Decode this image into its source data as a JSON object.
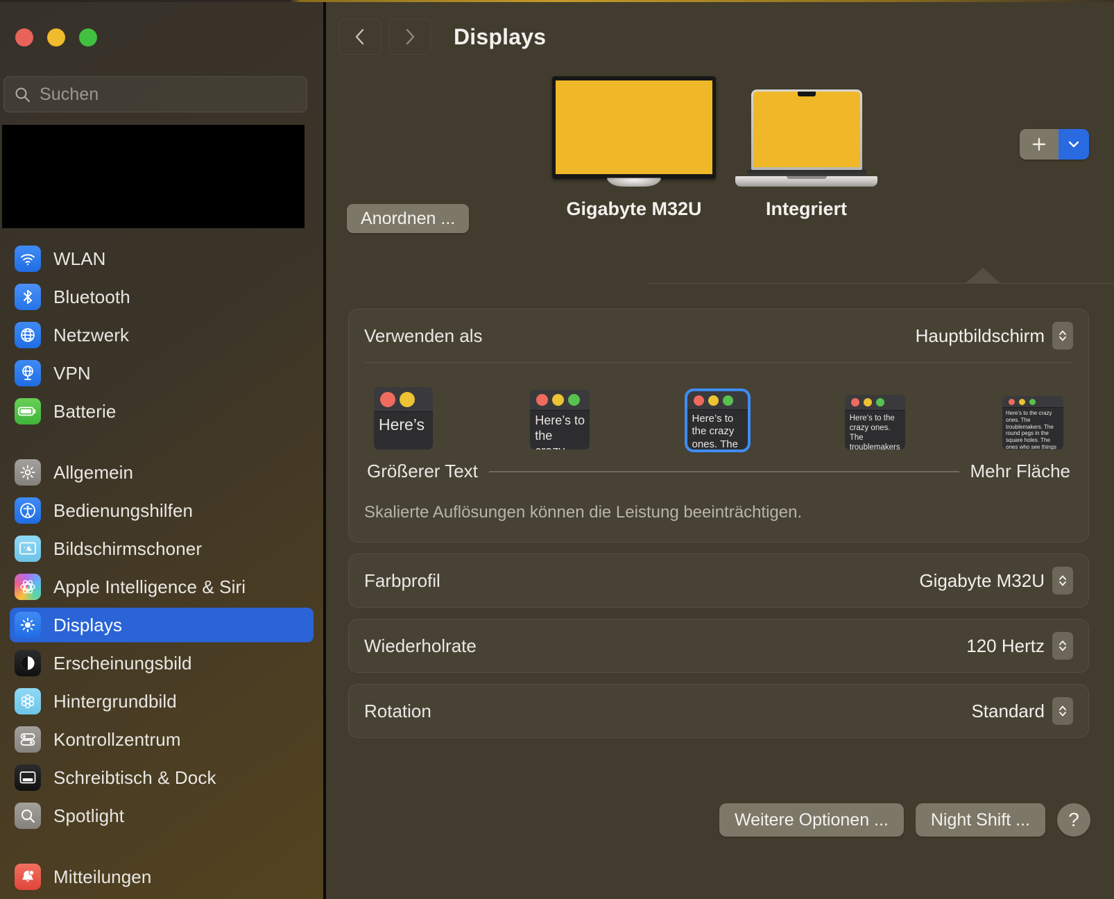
{
  "window": {
    "traffic_lights": [
      {
        "name": "close",
        "color": "#e8645a"
      },
      {
        "name": "minimize",
        "color": "#f0bb2c"
      },
      {
        "name": "zoom",
        "color": "#42c041"
      }
    ]
  },
  "sidebar": {
    "search": {
      "placeholder": "Suchen",
      "value": ""
    },
    "groups": [
      {
        "items": [
          {
            "label": "WLAN",
            "icon": "wifi-icon"
          },
          {
            "label": "Bluetooth",
            "icon": "bluetooth-icon"
          },
          {
            "label": "Netzwerk",
            "icon": "globe-icon"
          },
          {
            "label": "VPN",
            "icon": "vpn-globe-icon"
          },
          {
            "label": "Batterie",
            "icon": "battery-icon"
          }
        ]
      },
      {
        "items": [
          {
            "label": "Allgemein",
            "icon": "gear-icon"
          },
          {
            "label": "Bedienungshilfen",
            "icon": "accessibility-icon"
          },
          {
            "label": "Bildschirmschoner",
            "icon": "screensaver-icon"
          },
          {
            "label": "Apple Intelligence & Siri",
            "icon": "siri-icon"
          },
          {
            "label": "Displays",
            "icon": "brightness-icon",
            "selected": true
          },
          {
            "label": "Erscheinungsbild",
            "icon": "appearance-icon"
          },
          {
            "label": "Hintergrundbild",
            "icon": "wallpaper-icon"
          },
          {
            "label": "Kontrollzentrum",
            "icon": "control-center-icon"
          },
          {
            "label": "Schreibtisch & Dock",
            "icon": "desktop-dock-icon"
          },
          {
            "label": "Spotlight",
            "icon": "spotlight-icon"
          }
        ]
      },
      {
        "items": [
          {
            "label": "Mitteilungen",
            "icon": "notifications-icon"
          }
        ]
      }
    ]
  },
  "header": {
    "back_label": "‹",
    "forward_label": "›",
    "title": "Displays"
  },
  "preview": {
    "arrange_button": "Anordnen ...",
    "displays": [
      {
        "name": "Gigabyte M32U",
        "type": "monitor",
        "selected": true
      },
      {
        "name": "Integriert",
        "type": "laptop",
        "selected": false
      }
    ],
    "add_button": "+",
    "add_menu_chevron": "⌄"
  },
  "main": {
    "use_as": {
      "label": "Verwenden als",
      "value": "Hauptbildschirm"
    },
    "scaling": {
      "thumbnails": [
        {
          "id": "t1",
          "dots": [
            "#ef6b5e",
            "#edc233"
          ],
          "text": "Here’s"
        },
        {
          "id": "t2",
          "dots": [
            "#ef6b5e",
            "#edc233",
            "#58c14f"
          ],
          "text": "Here’s to the crazy ones. The troublemakers."
        },
        {
          "id": "t3",
          "dots": [
            "#ef6b5e",
            "#edc233",
            "#58c14f"
          ],
          "text": "Here’s to the crazy ones. The troublemakers. The round pegs. The ones who see things differently.",
          "selected": true
        },
        {
          "id": "t4",
          "dots": [
            "#ef6b5e",
            "#edc233",
            "#58c14f"
          ],
          "text": "Here’s to the crazy ones. The troublemakers. The round pegs. The ones who see things differently. They’re not fond of rules. And they have no respect for the status quo."
        },
        {
          "id": "t5",
          "dots": [
            "#ef6b5e",
            "#edc233",
            "#58c14f"
          ],
          "text": "Here’s to the crazy ones. The troublemakers. The round pegs in the square holes. The ones who see things differently. They’re not fond of rules. And they have no respect for the status quo. You can quote them, disagree with them, glorify or vilify them. About the only thing you can’t do is ignore them. Because they change things."
        }
      ],
      "left_label": "Größerer Text",
      "right_label": "Mehr Fläche",
      "note": "Skalierte Auflösungen können die Leistung beeinträchtigen."
    },
    "settings_rows": [
      {
        "label": "Farbprofil",
        "value": "Gigabyte M32U"
      },
      {
        "label": "Wiederholrate",
        "value": "120 Hertz"
      },
      {
        "label": "Rotation",
        "value": "Standard"
      }
    ],
    "footer_buttons": [
      {
        "label": "Weitere Optionen ..."
      },
      {
        "label": "Night Shift ..."
      }
    ],
    "help_button": "?"
  },
  "colors": {
    "accent_blue": "#2a64d6",
    "selection_blue": "#3f8cf4",
    "screen_yellow": "#f0b828",
    "main_bg": "#423c2e"
  }
}
